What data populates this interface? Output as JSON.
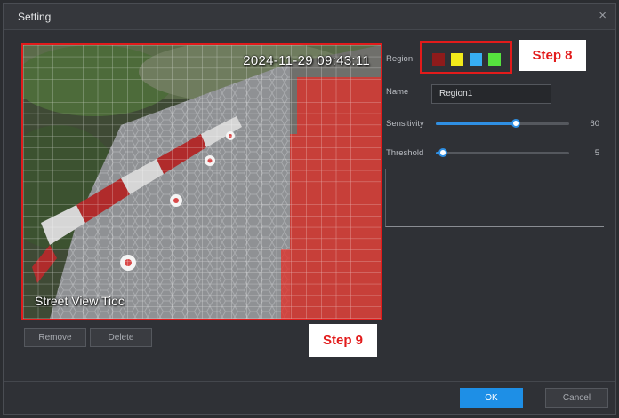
{
  "dialog": {
    "title": "Setting",
    "close_symbol": "×"
  },
  "video": {
    "timestamp": "2024-11-29 09:43:11",
    "channel_name": "Street View Tioc"
  },
  "buttons": {
    "remove": "Remove",
    "delete": "Delete",
    "ok": "OK",
    "cancel": "Cancel"
  },
  "panel": {
    "region_label": "Region",
    "region_colors": [
      "#8e1b1b",
      "#f2ea1a",
      "#37aef2",
      "#56e23e"
    ],
    "name_label": "Name",
    "name_value": "Region1",
    "sensitivity_label": "Sensitivity",
    "sensitivity_value": "60",
    "sensitivity_fraction": 0.6,
    "threshold_label": "Threshold",
    "threshold_value": "5",
    "threshold_fraction": 0.05
  },
  "annotations": {
    "step8": "Step 8",
    "step9": "Step 9"
  },
  "colors": {
    "accent": "#1e8fe6",
    "highlight": "#e21b1b"
  }
}
